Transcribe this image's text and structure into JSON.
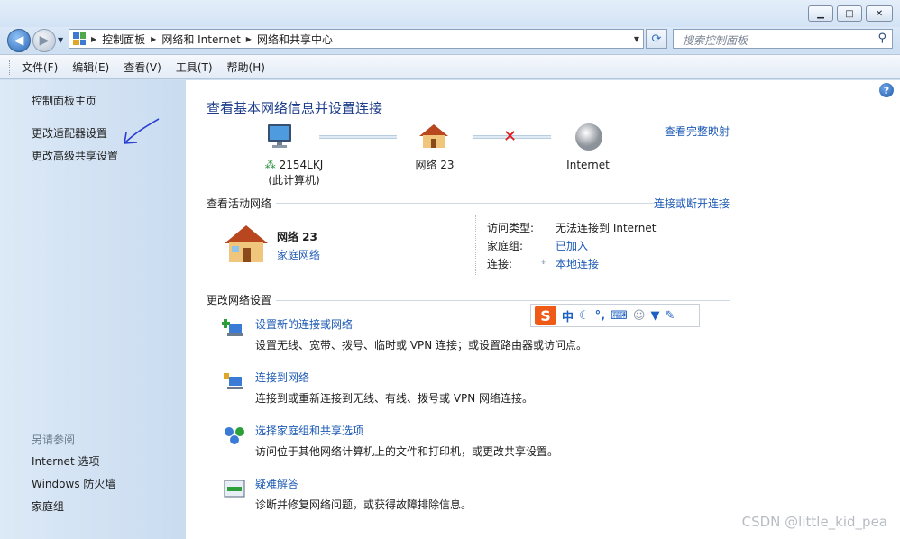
{
  "window": {
    "minimize_label": "▁",
    "maximize_label": "□",
    "close_label": "✕"
  },
  "address": {
    "crumbs": [
      "控制面板",
      "网络和 Internet",
      "网络和共享中心"
    ],
    "search_placeholder": "搜索控制面板"
  },
  "menu": {
    "items": [
      "文件(F)",
      "编辑(E)",
      "查看(V)",
      "工具(T)",
      "帮助(H)"
    ]
  },
  "sidebar": {
    "links": [
      "控制面板主页",
      "更改适配器设置",
      "更改高级共享设置"
    ],
    "see_also_title": "另请参阅",
    "see_also": [
      "Internet 选项",
      "Windows 防火墙",
      "家庭组"
    ]
  },
  "main": {
    "title": "查看基本网络信息并设置连接",
    "full_map_link": "查看完整映射",
    "map": {
      "computer_name": "2154LKJ",
      "computer_sub": "(此计算机)",
      "network": "网络 23",
      "internet": "Internet"
    },
    "active": {
      "section_title": "查看活动网络",
      "connect_link": "连接或断开连接",
      "network_name": "网络 23",
      "network_type": "家庭网络",
      "access_type_label": "访问类型:",
      "access_type_value": "无法连接到 Internet",
      "homegroup_label": "家庭组:",
      "homegroup_value": "已加入",
      "connection_label": "连接:",
      "connection_value": "本地连接"
    },
    "change_section_title": "更改网络设置",
    "tasks": [
      {
        "title": "设置新的连接或网络",
        "desc": "设置无线、宽带、拨号、临时或 VPN 连接；或设置路由器或访问点。"
      },
      {
        "title": "连接到网络",
        "desc": "连接到或重新连接到无线、有线、拨号或 VPN 网络连接。"
      },
      {
        "title": "选择家庭组和共享选项",
        "desc": "访问位于其他网络计算机上的文件和打印机，或更改共享设置。"
      },
      {
        "title": "疑难解答",
        "desc": "诊断并修复网络问题，或获得故障排除信息。"
      }
    ]
  },
  "ime": {
    "logo": "S",
    "mode": "中"
  },
  "watermark": "CSDN @little_kid_pea",
  "colors": {
    "link": "#1e5bb5",
    "title": "#1e3e8c",
    "sidebar_bg": "#d5e5f5"
  }
}
